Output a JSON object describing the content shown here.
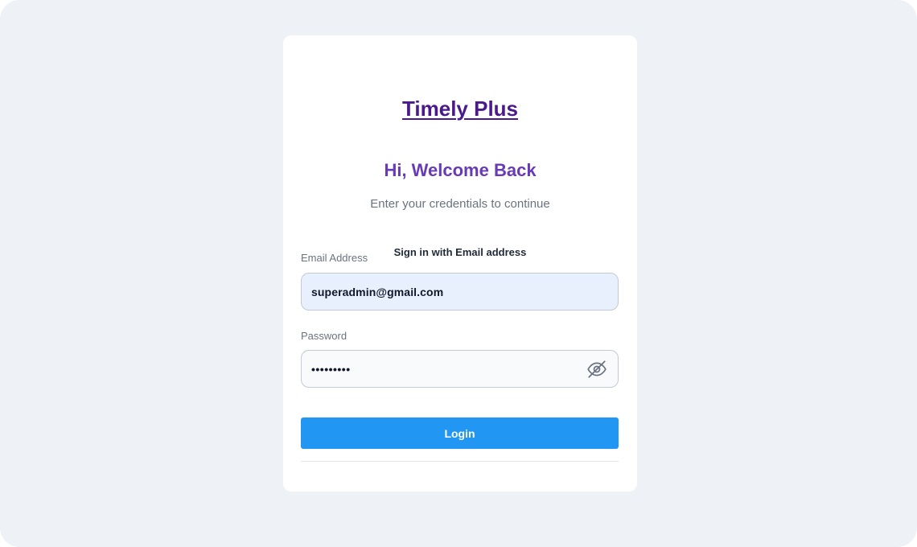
{
  "brand": {
    "name": "Timely Plus",
    "color": "#4a1a8c"
  },
  "welcome": {
    "heading": "Hi, Welcome Back",
    "subtitle": "Enter your credentials to continue",
    "heading_color": "#673ab7"
  },
  "signin_method": {
    "label": "Sign in with Email address"
  },
  "email": {
    "label": "Email Address",
    "value": "superadmin@gmail.com"
  },
  "password": {
    "label": "Password",
    "masked_value": "•••••••••",
    "toggle_icon": "eye-off-icon"
  },
  "login_button": {
    "label": "Login",
    "color": "#2196f3"
  }
}
